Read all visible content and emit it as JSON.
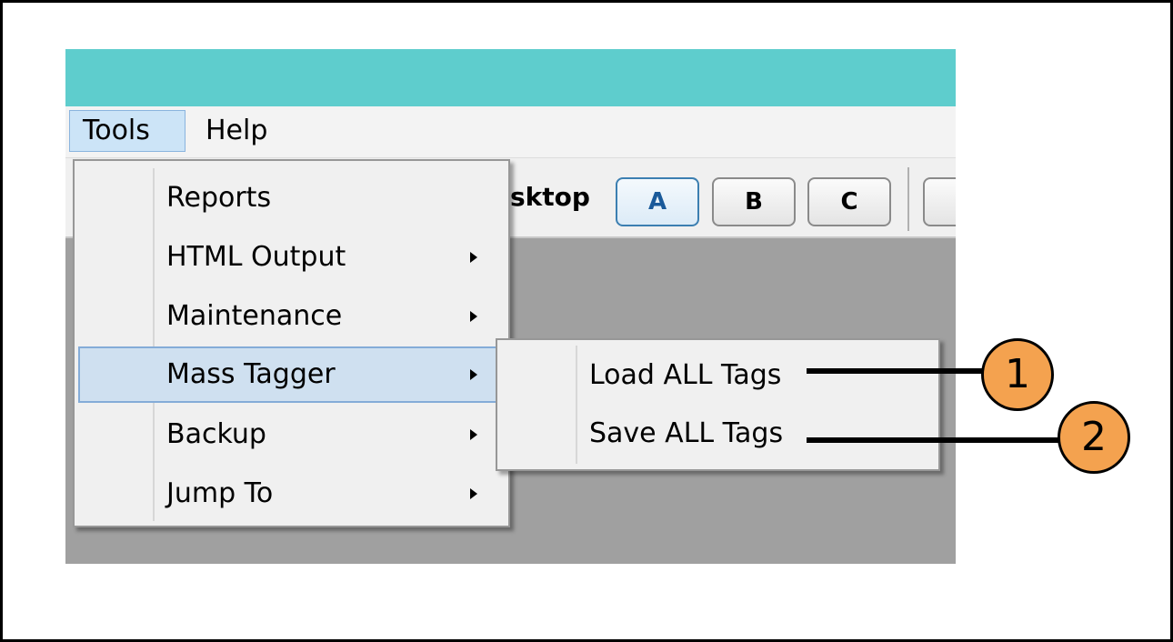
{
  "menubar": {
    "tools": "Tools",
    "help": "Help"
  },
  "toolbar": {
    "label_fragment": "esktop",
    "buttons": [
      "A",
      "B",
      "C"
    ]
  },
  "tools_menu": {
    "items": [
      {
        "label": "Reports",
        "has_submenu": false
      },
      {
        "label": "HTML Output",
        "has_submenu": true
      },
      {
        "label": "Maintenance",
        "has_submenu": true
      },
      {
        "label": "Mass Tagger",
        "has_submenu": true,
        "highlighted": true
      },
      {
        "label": "Backup",
        "has_submenu": true
      },
      {
        "label": "Jump To",
        "has_submenu": true
      }
    ]
  },
  "mass_tagger_submenu": {
    "items": [
      "Load ALL Tags",
      "Save ALL Tags"
    ]
  },
  "callouts": [
    "1",
    "2"
  ],
  "colors": {
    "titlebar": "#5ecdcd",
    "highlight": "#cfe0f0",
    "callout": "#f4a24f",
    "workspace": "#a0a0a0"
  }
}
